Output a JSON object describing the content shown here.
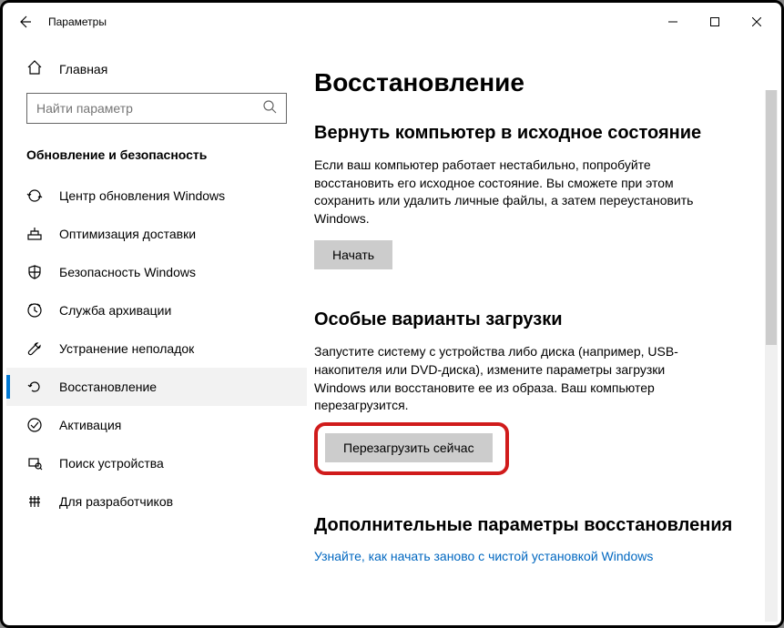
{
  "titlebar": {
    "title": "Параметры"
  },
  "sidebar": {
    "home": "Главная",
    "search_placeholder": "Найти параметр",
    "category": "Обновление и безопасность",
    "items": [
      {
        "id": "windows-update",
        "label": "Центр обновления Windows"
      },
      {
        "id": "delivery-optimization",
        "label": "Оптимизация доставки"
      },
      {
        "id": "windows-security",
        "label": "Безопасность Windows"
      },
      {
        "id": "backup",
        "label": "Служба архивации"
      },
      {
        "id": "troubleshoot",
        "label": "Устранение неполадок"
      },
      {
        "id": "recovery",
        "label": "Восстановление"
      },
      {
        "id": "activation",
        "label": "Активация"
      },
      {
        "id": "find-my-device",
        "label": "Поиск устройства"
      },
      {
        "id": "for-developers",
        "label": "Для разработчиков"
      }
    ]
  },
  "main": {
    "title": "Восстановление",
    "reset": {
      "heading": "Вернуть компьютер в исходное состояние",
      "text": "Если ваш компьютер работает нестабильно, попробуйте восстановить его исходное состояние. Вы сможете при этом сохранить или удалить личные файлы, а затем переустановить Windows.",
      "button": "Начать"
    },
    "advanced": {
      "heading": "Особые варианты загрузки",
      "text": "Запустите систему с устройства либо диска (например, USB-накопителя или DVD-диска), измените параметры загрузки Windows или восстановите ее из образа. Ваш компьютер перезагрузится.",
      "button": "Перезагрузить сейчас"
    },
    "more": {
      "heading": "Дополнительные параметры восстановления",
      "link": "Узнайте, как начать заново с чистой установкой Windows"
    }
  }
}
